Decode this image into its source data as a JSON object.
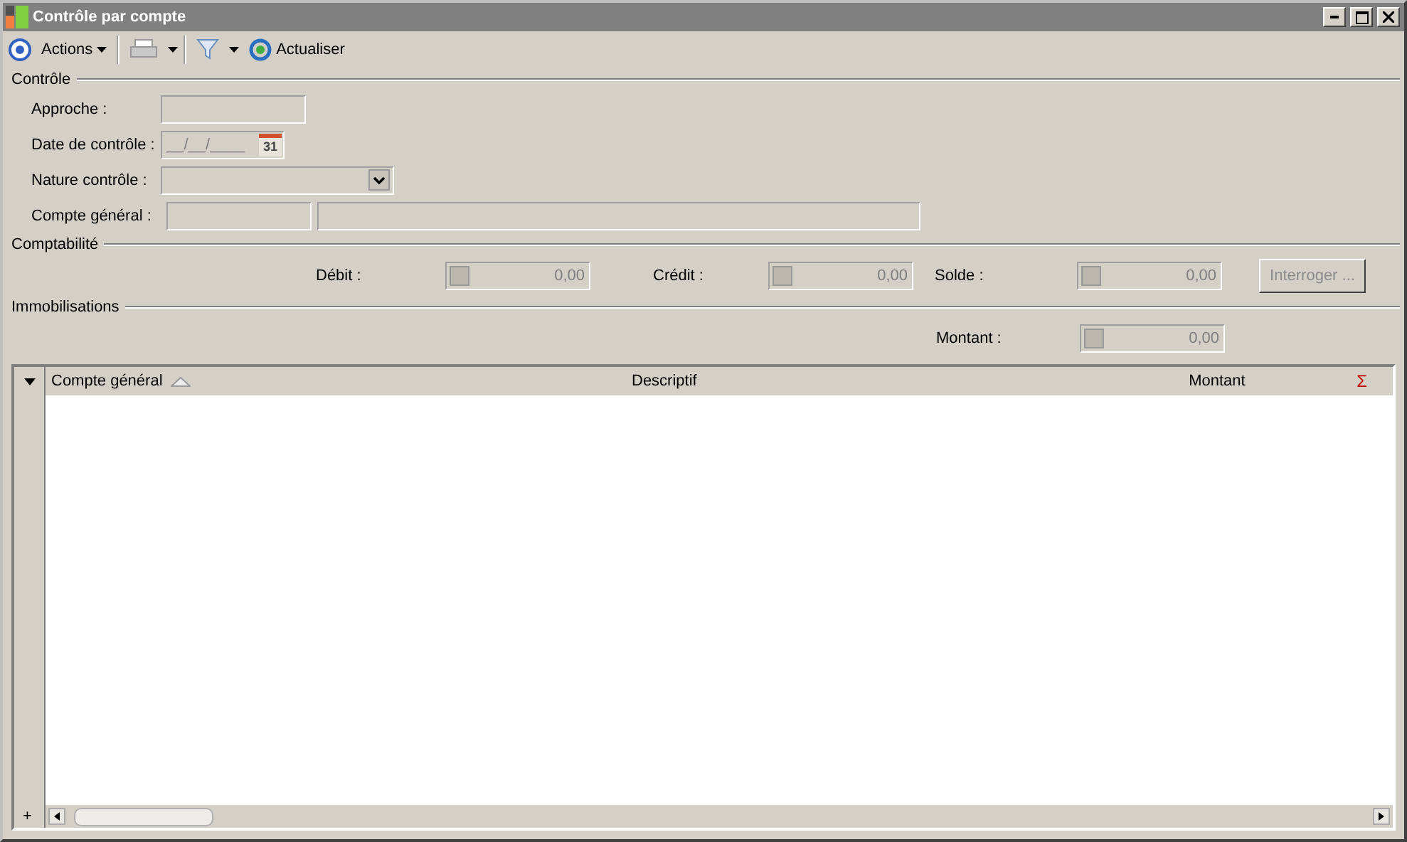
{
  "window": {
    "title": "Contrôle par compte"
  },
  "toolbar": {
    "actions": "Actions",
    "refresh": "Actualiser"
  },
  "controle": {
    "title": "Contrôle",
    "approche": {
      "label": "Approche :"
    },
    "date": {
      "label": "Date de contrôle :",
      "value": "__/__/____",
      "calendar": "31"
    },
    "nature": {
      "label": "Nature contrôle :"
    },
    "compte": {
      "label": "Compte général :"
    }
  },
  "comptabilite": {
    "title": "Comptabilité",
    "amounts": [
      {
        "label": "Débit :",
        "value": "0,00"
      },
      {
        "label": "Crédit :",
        "value": "0,00"
      },
      {
        "label": "Solde :",
        "value": "0,00"
      }
    ],
    "button": {
      "label": "Interroger ...",
      "disabled": true
    }
  },
  "immobilisations": {
    "title": "Immobilisations",
    "montant": {
      "label": "Montant :",
      "value": "0,00"
    }
  },
  "table": {
    "columns": [
      {
        "label": "Compte général",
        "sorted": true
      },
      {
        "label": "Descriptif",
        "sorted": false
      },
      {
        "label": "Montant",
        "sorted": false
      }
    ],
    "sum": "Σ",
    "add": "+"
  }
}
